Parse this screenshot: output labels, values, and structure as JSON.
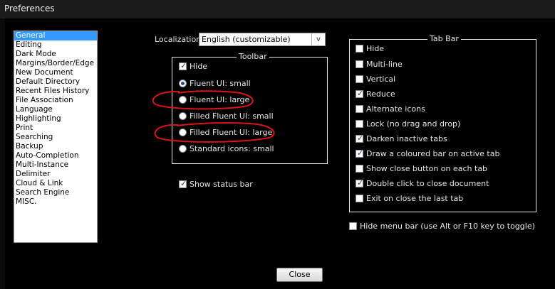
{
  "window": {
    "title": "Preferences"
  },
  "categories": [
    "General",
    "Editing",
    "Dark Mode",
    "Margins/Border/Edge",
    "New Document",
    "Default Directory",
    "Recent Files History",
    "File Association",
    "Language",
    "Highlighting",
    "Print",
    "Searching",
    "Backup",
    "Auto-Completion",
    "Multi-Instance",
    "Delimiter",
    "Cloud & Link",
    "Search Engine",
    "MISC."
  ],
  "selected_category": "General",
  "localization": {
    "label": "Localization",
    "value": "English (customizable)",
    "arrow": "v"
  },
  "toolbar": {
    "title": "Toolbar",
    "hide": {
      "label": "Hide",
      "checked": true
    },
    "options": [
      {
        "label": "Fluent UI: small",
        "selected": true
      },
      {
        "label": "Fluent UI: large",
        "selected": false
      },
      {
        "label": "Filled Fluent UI: small",
        "selected": false
      },
      {
        "label": "Filled Fluent UI: large",
        "selected": false
      },
      {
        "label": "Standard icons: small",
        "selected": false
      }
    ]
  },
  "show_status_bar": {
    "label": "Show status bar",
    "checked": true
  },
  "tabbar": {
    "title": "Tab Bar",
    "items": [
      {
        "label": "Hide",
        "checked": false
      },
      {
        "label": "Multi-line",
        "checked": false
      },
      {
        "label": "Vertical",
        "checked": false
      },
      {
        "label": "Reduce",
        "checked": true
      },
      {
        "label": "Alternate icons",
        "checked": false
      },
      {
        "label": "Lock (no drag and drop)",
        "checked": false
      },
      {
        "label": "Darken inactive tabs",
        "checked": true
      },
      {
        "label": "Draw a coloured bar on active tab",
        "checked": true
      },
      {
        "label": "Show close button on each tab",
        "checked": false
      },
      {
        "label": "Double click to close document",
        "checked": true
      },
      {
        "label": "Exit on close the last tab",
        "checked": false
      }
    ]
  },
  "hide_menu_bar": {
    "label": "Hide menu bar (use Alt or F10 key to toggle)",
    "checked": false
  },
  "close_button": "Close",
  "check_mark": "✓",
  "annotation_color": "#d9141b"
}
